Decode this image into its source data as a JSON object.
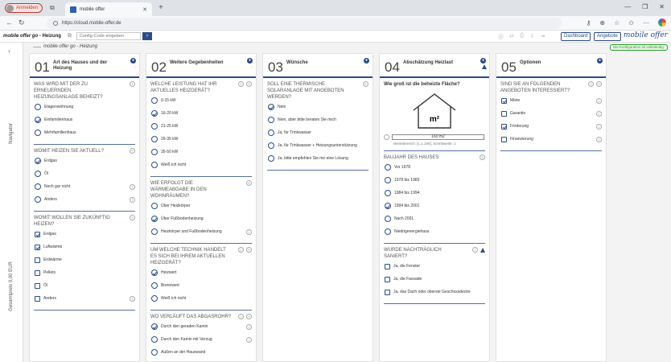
{
  "browser": {
    "profile_label": "Anmelden",
    "tab_title": "mobile offer",
    "url": "https://cloud.mobile-offer.de"
  },
  "app": {
    "title_prefix": "mobile offer go",
    "title_suffix": " - Heizung",
    "code_placeholder": "Config-Code eingeben",
    "go_label": "›",
    "dashboard_label": "Dashboard",
    "offers_label": "Angebote",
    "brand": "mobile offer",
    "breadcrumb": "mobile offer go - Heizung",
    "saved_badge": "Die Konfiguration ist vollständig.",
    "rail_navigator": "Navigator",
    "rail_total": "Gesamtpreis 0,00 EUR"
  },
  "colors": {
    "accent": "#2a4b8c",
    "success": "#2e9c2e",
    "profile": "#c0392b"
  },
  "columns": [
    {
      "num": "01",
      "title": "Art des Hauses und der Heizung",
      "sections": [
        {
          "question": "Was wird mit der zu erneuernden Heizungsanlage beheizt?",
          "type": "radio",
          "options": [
            {
              "label": "Etagenwohnung",
              "on": false
            },
            {
              "label": "Einfamilienhaus",
              "on": true
            },
            {
              "label": "Mehrfamilienhaus",
              "on": false
            }
          ]
        },
        {
          "question": "Womit heizen Sie aktuell?",
          "type": "radio",
          "options": [
            {
              "label": "Erdgas",
              "on": true
            },
            {
              "label": "Öl",
              "on": false
            },
            {
              "label": "Noch gar nicht",
              "on": false,
              "info": true
            },
            {
              "label": "Anders",
              "on": false,
              "info": true
            }
          ]
        },
        {
          "question": "Womit wollen Sie zukünftig heizen?",
          "type": "check",
          "options": [
            {
              "label": "Erdgas",
              "on": true
            },
            {
              "label": "Luftwärme",
              "on": true
            },
            {
              "label": "Erdwärme",
              "on": false
            },
            {
              "label": "Pellets",
              "on": false
            },
            {
              "label": "Öl",
              "on": false
            },
            {
              "label": "Anders",
              "on": false,
              "info": true
            }
          ]
        }
      ]
    },
    {
      "num": "02",
      "title": "Weitere Gegebenheiten",
      "sections": [
        {
          "question": "Welche Leistung hat Ihr aktuelles Heizgerät?",
          "type": "radio",
          "q_info": true,
          "options": [
            {
              "label": "0-15 kW",
              "on": false
            },
            {
              "label": "16-20 kW",
              "on": true
            },
            {
              "label": "21-25 kW",
              "on": false
            },
            {
              "label": "26-35 kW",
              "on": false
            },
            {
              "label": "35-50 kW",
              "on": false
            },
            {
              "label": "Weiß ich nicht",
              "on": false
            }
          ]
        },
        {
          "question": "Wie erfolgt die Wärmeabgabe in den Wohnräumen?",
          "type": "radio",
          "options": [
            {
              "label": "Über Heizkörper",
              "on": false
            },
            {
              "label": "Über Fußbodenheizung",
              "on": true
            },
            {
              "label": "Heizkörper und Fußbodenheizung",
              "on": false,
              "info": true
            }
          ]
        },
        {
          "question": "Um welche Technik handelt es sich bei Ihrem aktuellen Heizgerät?",
          "type": "radio",
          "q_info": true,
          "options": [
            {
              "label": "Heizwert",
              "on": true
            },
            {
              "label": "Brennwert",
              "on": false
            },
            {
              "label": "Weiß ich nicht",
              "on": false
            }
          ]
        },
        {
          "question": "Wo verläuft das Abgasrohr?",
          "type": "radio",
          "q_info": true,
          "options": [
            {
              "label": "Durch den geraden Kamin",
              "on": true,
              "info": true
            },
            {
              "label": "Durch den Kamin mit Verzug",
              "on": false,
              "info": true
            },
            {
              "label": "Außen an der Hauswand",
              "on": false
            }
          ]
        }
      ]
    },
    {
      "num": "03",
      "title": "Wünsche",
      "sections": [
        {
          "question": "Soll eine thermische Solaranlage mit angeboten werden?",
          "type": "radio",
          "options": [
            {
              "label": "Nein",
              "on": true
            },
            {
              "label": "Nein, aber bitte beraten Sie mich",
              "on": false
            },
            {
              "label": "Ja, für Trinkwasser",
              "on": false
            },
            {
              "label": "Ja, für Trinkwasser + Heizungsunterstützung",
              "on": false
            },
            {
              "label": "Ja, bitte empfehlen Sie mir eine Lösung",
              "on": false
            }
          ]
        }
      ]
    },
    {
      "num": "04",
      "title": "Abschätzung Heizlast",
      "warn": true,
      "area": {
        "question": "Wie groß ist die beheizte Fläche?",
        "unit": "m²",
        "value": "160 m2",
        "hint": "Wertebereich: [1,1.180], Schrittweite: 1"
      },
      "sections": [
        {
          "question": "Baujahr des Hauses",
          "type": "radio",
          "options": [
            {
              "label": "Vor 1978",
              "on": false
            },
            {
              "label": "1978 bis 1983",
              "on": false
            },
            {
              "label": "1984 bis 1994",
              "on": false
            },
            {
              "label": "1994 bis 2001",
              "on": true
            },
            {
              "label": "Nach 2001",
              "on": false
            },
            {
              "label": "Niedrigenergiehaus",
              "on": false
            }
          ]
        },
        {
          "question": "Wurde nachträglich saniert?",
          "type": "check",
          "q_info": true,
          "q_warn": true,
          "options": [
            {
              "label": "Ja, die Fenster",
              "on": false
            },
            {
              "label": "Ja, die Fassade",
              "on": false
            },
            {
              "label": "Ja, das Dach oder oberste Geschossdecke",
              "on": false
            }
          ]
        }
      ]
    },
    {
      "num": "05",
      "title": "Optionen",
      "sections": [
        {
          "question": "Sind Sie an folgenden Angeboten interessiert?",
          "type": "check",
          "q_info": true,
          "options": [
            {
              "label": "Miete",
              "on": true,
              "info": true
            },
            {
              "label": "Garantie",
              "on": false,
              "info": true
            },
            {
              "label": "Förderung",
              "on": true,
              "info": true
            },
            {
              "label": "Finanzierung",
              "on": false,
              "info": true
            }
          ]
        }
      ]
    }
  ]
}
